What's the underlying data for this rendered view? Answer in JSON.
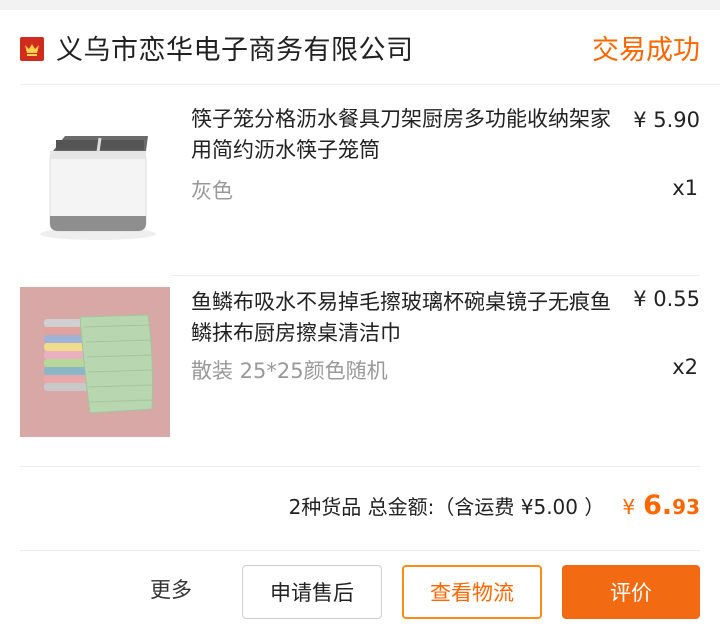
{
  "shop": {
    "name": "义乌市恋华电子商务有限公司",
    "status": "交易成功",
    "icon": "shop-badge-icon"
  },
  "items": [
    {
      "title": "筷子笼分格沥水餐具刀架厨房多功能收纳架家用简约沥水筷子笼筒",
      "price": "¥ 5.90",
      "sku": "灰色",
      "qty": "x1",
      "image": "utensil-holder-image"
    },
    {
      "title": "鱼鳞布吸水不易掉毛擦玻璃杯碗桌镜子无痕鱼鳞抹布厨房擦桌清洁巾",
      "price": "¥ 0.55",
      "sku": "散装 25*25颜色随机",
      "qty": "x2",
      "image": "cleaning-cloth-image"
    }
  ],
  "summary": {
    "label": "2种货品 总金额:（含运费 ¥5.00 ）",
    "currency": "¥",
    "total_int": "6.",
    "total_dec": "93"
  },
  "actions": {
    "more": "更多",
    "after_sale": "申请售后",
    "logistics": "查看物流",
    "review": "评价"
  },
  "colors": {
    "accent": "#ff6600",
    "button_fill": "#f26a12",
    "shop_icon": "#d12a1e"
  }
}
